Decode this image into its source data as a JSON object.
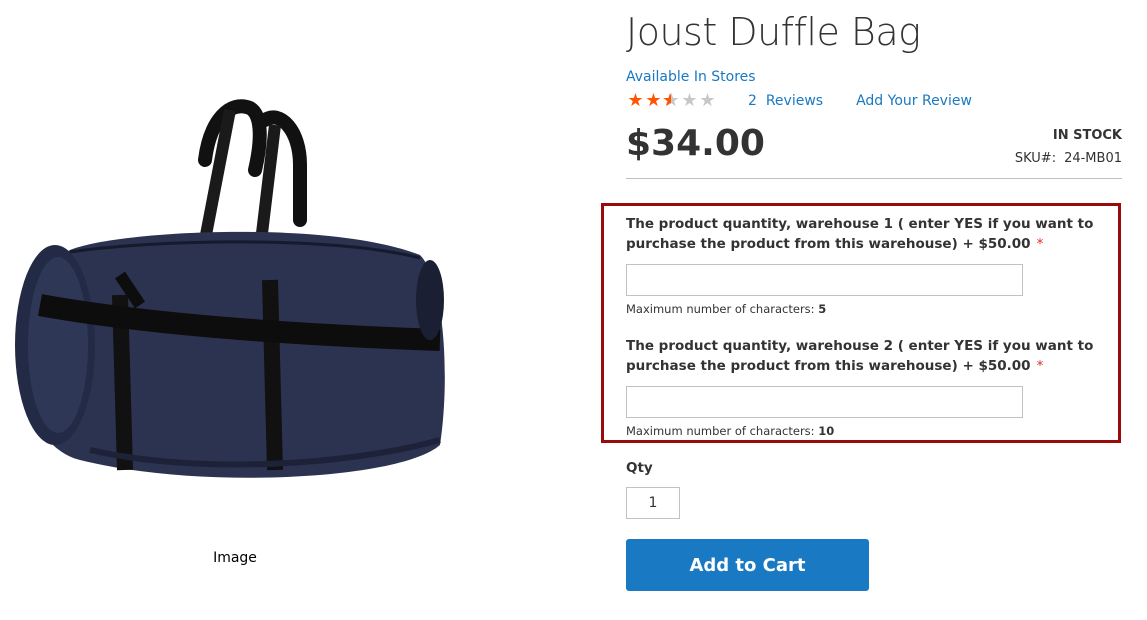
{
  "product": {
    "title": "Joust Duffle Bag",
    "availability_link": "Available In Stores",
    "rating": {
      "stars_filled": 2.5,
      "stars_total": 5,
      "reviews_count": "2",
      "reviews_text": "Reviews",
      "add_review_label": "Add Your Review"
    },
    "price": "$34.00",
    "stock_status": "IN STOCK",
    "sku_label": "SKU#:",
    "sku_value": "24-MB01"
  },
  "media": {
    "image_name": "duffle-bag-image",
    "caption": "Image"
  },
  "options": [
    {
      "label": "The product quantity, warehouse 1 ( enter YES if you want to purchase the product from this warehouse) + $50.00",
      "required_marker": "*",
      "value": "",
      "note_prefix": "Maximum number of characters:",
      "note_value": "5"
    },
    {
      "label": "The product quantity, warehouse 2 ( enter YES if you want to purchase the product from this warehouse) + $50.00",
      "required_marker": "*",
      "value": "",
      "note_prefix": "Maximum number of characters:",
      "note_value": "10"
    }
  ],
  "qty": {
    "label": "Qty",
    "value": "1"
  },
  "cart": {
    "add_to_cart_label": "Add to Cart"
  },
  "colors": {
    "link": "#1979c3",
    "star": "#ff5501",
    "highlight_border": "#9b0a0a",
    "required": "#e02b27",
    "button": "#1979c3"
  }
}
